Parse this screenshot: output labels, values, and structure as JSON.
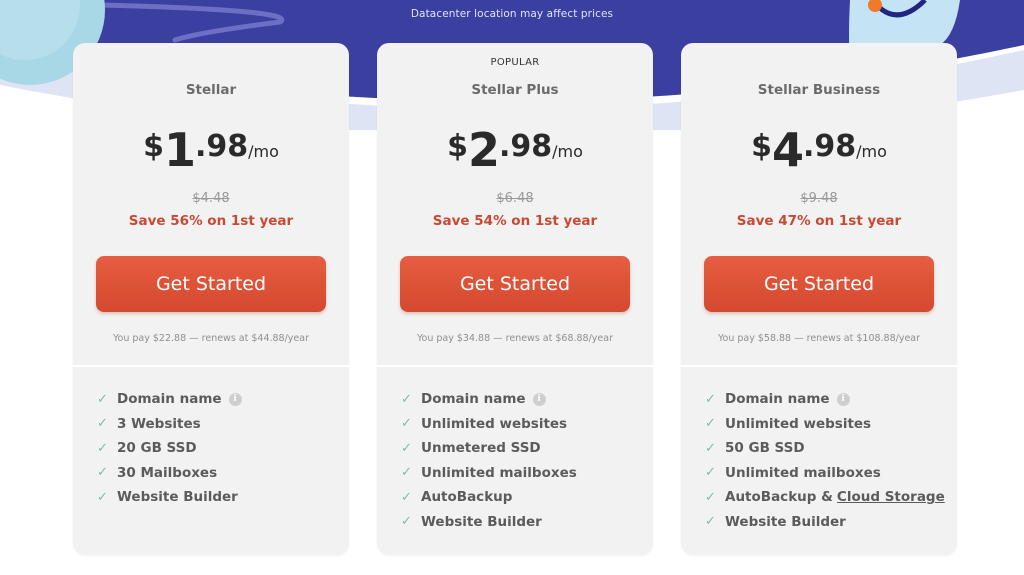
{
  "hero": {
    "note": "Datacenter location may affect prices",
    "colors": {
      "space": "#3a3fa0",
      "ring": "#dfe4f5",
      "planet": "#a8d7e6",
      "mascot": "#c4e4f6",
      "accent_orange": "#f07a2a"
    }
  },
  "colors": {
    "card_bg": "#f2f2f2",
    "cta": "#df5438",
    "save_text": "#c74a35",
    "check": "#88b5b5"
  },
  "plans": [
    {
      "badge": "",
      "name": "Stellar",
      "currency": "$",
      "price_int": "1",
      "price_dec": ".98",
      "period": "/mo",
      "old_price": "$4.48",
      "save": "Save 56% on 1st year",
      "cta": "Get Started",
      "renew": "You pay $22.88 — renews at $44.88/year",
      "features": [
        "Domain name",
        "3 Websites",
        "20 GB SSD",
        "30 Mailboxes",
        "Website Builder"
      ]
    },
    {
      "badge": "POPULAR",
      "name": "Stellar Plus",
      "currency": "$",
      "price_int": "2",
      "price_dec": ".98",
      "period": "/mo",
      "old_price": "$6.48",
      "save": "Save 54% on 1st year",
      "cta": "Get Started",
      "renew": "You pay $34.88 — renews at $68.88/year",
      "features": [
        "Domain name",
        "Unlimited websites",
        "Unmetered SSD",
        "Unlimited mailboxes",
        "AutoBackup",
        "Website Builder"
      ]
    },
    {
      "badge": "",
      "name": "Stellar Business",
      "currency": "$",
      "price_int": "4",
      "price_dec": ".98",
      "period": "/mo",
      "old_price": "$9.48",
      "save": "Save 47% on 1st year",
      "cta": "Get Started",
      "renew": "You pay $58.88 — renews at $108.88/year",
      "features": [
        "Domain name",
        "Unlimited websites",
        "50 GB SSD",
        "Unlimited mailboxes",
        "AutoBackup &",
        "Website Builder"
      ],
      "feature_link": "Cloud Storage"
    }
  ],
  "icons": {
    "check": "✓",
    "info": "i"
  }
}
